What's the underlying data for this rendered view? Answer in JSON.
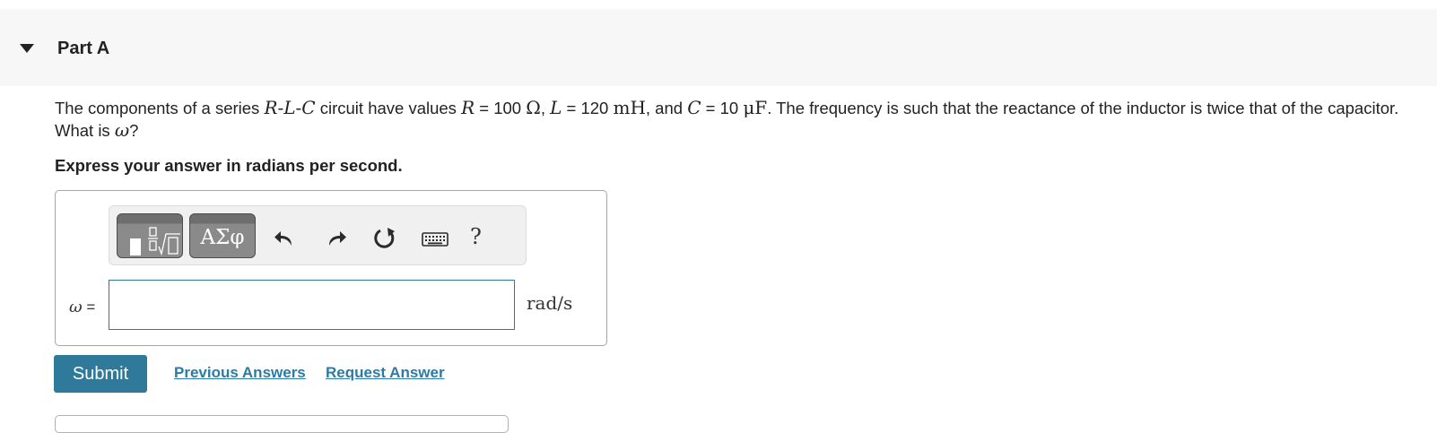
{
  "part": {
    "title": "Part A"
  },
  "question": {
    "t1": "The components of a series ",
    "m_rlc": "R-L-C",
    "t2": " circuit have values ",
    "m_R": "R",
    "t3": " = 100 ",
    "m_ohm": "Ω",
    "t4": ", ",
    "m_L": "L",
    "t5": " = 120 ",
    "m_mH": "mH",
    "t6": ", and ",
    "m_C": "C",
    "t7": " = 10 ",
    "m_uF": "μF",
    "t8": ". The frequency is such that the reactance of the inductor is twice that of the capacitor. What is ",
    "m_w": "ω",
    "t9": "?"
  },
  "instruction": "Express your answer in radians per second.",
  "toolbar": {
    "greek_label": "ΑΣφ",
    "help_label": "?"
  },
  "answer": {
    "variable": "ω",
    "equals": " =",
    "value": "",
    "unit": "rad/s"
  },
  "actions": {
    "submit_label": "Submit",
    "previous_answers_label": "Previous Answers",
    "request_answer_label": "Request Answer"
  },
  "colors": {
    "accent": "#2f7a9b",
    "link": "#2d7aa6",
    "header_bg": "#f7f7f7"
  }
}
